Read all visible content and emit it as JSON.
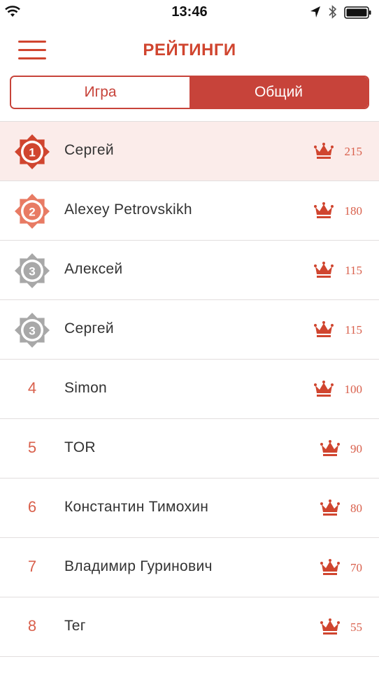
{
  "status_bar": {
    "time": "13:46"
  },
  "header": {
    "title": "РЕЙТИНГИ"
  },
  "tabs": [
    {
      "label": "Игра",
      "active": false
    },
    {
      "label": "Общий",
      "active": true
    }
  ],
  "colors": {
    "accent": "#c7433a",
    "gold": "#d0452f",
    "silver": "#a8a8a8",
    "bronze": "#e87b64",
    "highlight": "#fbecea"
  },
  "ratings": [
    {
      "rank": "1",
      "badge": "first",
      "name": "Сергей",
      "score": "215"
    },
    {
      "rank": "2",
      "badge": "second",
      "name": "Alexey Petrovskikh",
      "score": "180"
    },
    {
      "rank": "3",
      "badge": "third",
      "name": "Алексей",
      "score": "115"
    },
    {
      "rank": "3",
      "badge": "third",
      "name": "Сергей",
      "score": "115"
    },
    {
      "rank": "4",
      "badge": "none",
      "name": "Simon",
      "score": "100"
    },
    {
      "rank": "5",
      "badge": "none",
      "name": "TOR",
      "score": "90"
    },
    {
      "rank": "6",
      "badge": "none",
      "name": "Константин Тимохин",
      "score": "80"
    },
    {
      "rank": "7",
      "badge": "none",
      "name": "Владимир Гуринович",
      "score": "70"
    },
    {
      "rank": "8",
      "badge": "none",
      "name": "Teг",
      "score": "55"
    }
  ]
}
